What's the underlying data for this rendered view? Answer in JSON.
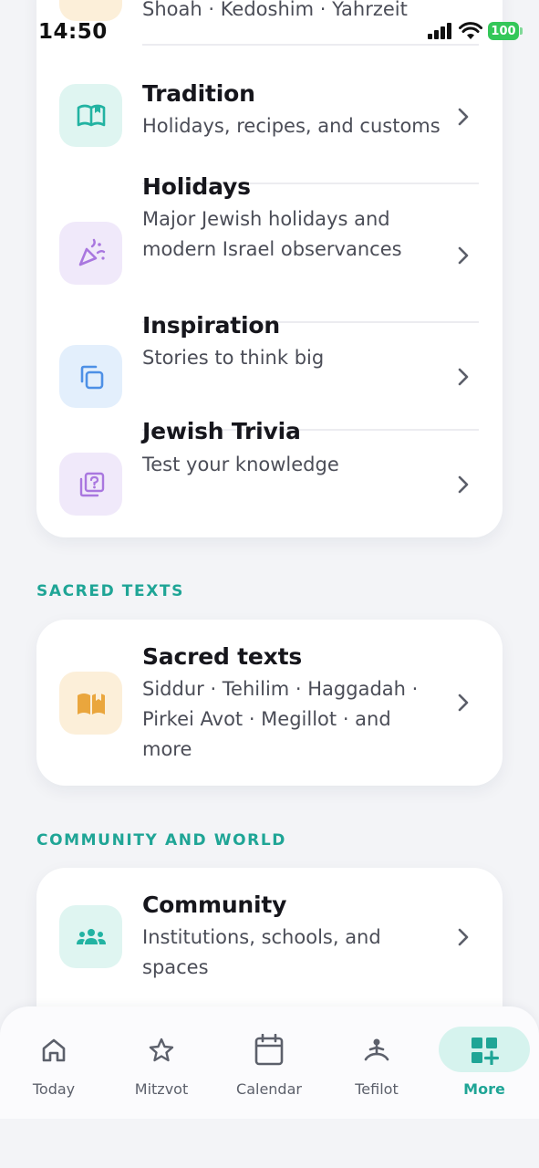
{
  "status": {
    "time": "14:50",
    "battery": "100"
  },
  "top_card": {
    "partial_subtitle": "Shoah · Kedoshim · Yahrzeit",
    "rows": [
      {
        "title": "Tradition",
        "subtitle": "Holidays, recipes, and customs",
        "icon": "open-book-icon"
      },
      {
        "title": "Holidays",
        "subtitle": "Major Jewish holidays and modern Israel observances",
        "icon": "party-popper-icon"
      },
      {
        "title": "Inspiration",
        "subtitle": "Stories to think big",
        "icon": "copy-squares-icon"
      },
      {
        "title": "Jewish Trivia",
        "subtitle": "Test your knowledge",
        "icon": "question-box-icon"
      }
    ]
  },
  "sacred_section": {
    "label": "SACRED TEXTS",
    "row": {
      "title": "Sacred texts",
      "subtitle": "Siddur · Tehilim · Haggadah · Pirkei Avot · Megillot · and more",
      "icon": "book-icon"
    }
  },
  "community_section": {
    "label": "COMMUNITY AND WORLD",
    "row": {
      "title": "Community",
      "subtitle": "Institutions, schools, and spaces",
      "icon": "people-group-icon"
    }
  },
  "tab_bar": {
    "tabs": [
      {
        "label": "Today",
        "icon": "home-icon"
      },
      {
        "label": "Mitzvot",
        "icon": "star-icon"
      },
      {
        "label": "Calendar",
        "icon": "calendar-icon"
      },
      {
        "label": "Tefilot",
        "icon": "prayer-person-icon"
      },
      {
        "label": "More",
        "icon": "grid-plus-icon",
        "active": true
      }
    ]
  },
  "colors": {
    "accent": "#1fa596",
    "teal_icon_bg": "#dff5f1",
    "purple_icon_bg": "#f0e9fa",
    "blue_icon_bg": "#e3effc",
    "amber_icon_bg": "#fcefd9",
    "active_tab_pill": "#d6f3ee"
  }
}
